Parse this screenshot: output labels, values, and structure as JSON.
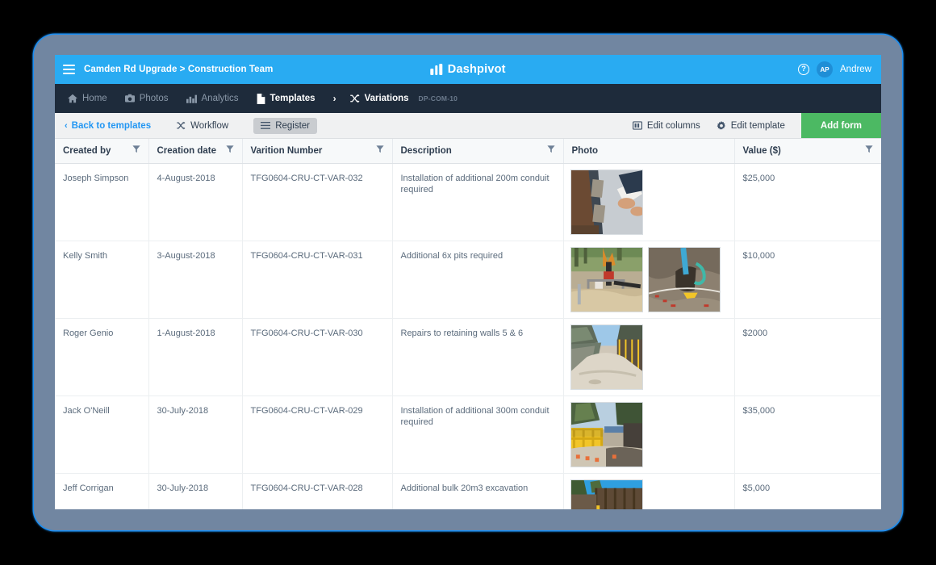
{
  "topbar": {
    "menu_icon": "hamburger-icon",
    "breadcrumb": "Camden Rd Upgrade > Construction Team",
    "brand": "Dashpivot",
    "help_icon": "question-mark-icon",
    "avatar_initials": "AP",
    "username": "Andrew",
    "bg_color": "#29abf2"
  },
  "nav": {
    "items": [
      {
        "label": "Home",
        "icon": "home-icon",
        "active": false
      },
      {
        "label": "Photos",
        "icon": "camera-icon",
        "active": false
      },
      {
        "label": "Analytics",
        "icon": "bar-chart-icon",
        "active": false
      },
      {
        "label": "Templates",
        "icon": "document-icon",
        "active": true
      }
    ],
    "separator": "›",
    "current": {
      "label": "Variations",
      "icon": "shuffle-icon",
      "code": "DP-COM-10"
    },
    "bg_color": "#1e2b3b"
  },
  "toolbar": {
    "back_label": "Back to templates",
    "back_chevron": "‹",
    "workflow_label": "Workflow",
    "workflow_icon": "shuffle-icon",
    "register_label": "Register",
    "register_icon": "list-icon",
    "edit_columns_label": "Edit columns",
    "edit_columns_icon": "columns-icon",
    "edit_template_label": "Edit template",
    "edit_template_icon": "gear-icon",
    "add_form_label": "Add form",
    "add_form_color": "#4cb963"
  },
  "table": {
    "columns": [
      {
        "label": "Created by",
        "filter": true
      },
      {
        "label": "Creation date",
        "filter": true
      },
      {
        "label": "Varition Number",
        "filter": true
      },
      {
        "label": "Description",
        "filter": true
      },
      {
        "label": "Photo",
        "filter": false
      },
      {
        "label": "Value ($)",
        "filter": true
      }
    ],
    "rows": [
      {
        "created_by": "Joseph Simpson",
        "creation_date": "4-August-2018",
        "variation_number": "TFG0604-CRU-CT-VAR-032",
        "description": "Installation of additional 200m conduit required",
        "photos": [
          "photo-timber-formwork-inspection"
        ],
        "value": "$25,000"
      },
      {
        "created_by": "Kelly Smith",
        "creation_date": "3-August-2018",
        "variation_number": "TFG0604-CRU-CT-VAR-031",
        "description": "Additional 6x pits required",
        "photos": [
          "photo-excavator-trench-work",
          "photo-rock-trench-conduit"
        ],
        "value": "$10,000"
      },
      {
        "created_by": "Roger Genio",
        "creation_date": "1-August-2018",
        "variation_number": "TFG0604-CRU-CT-VAR-030",
        "description": "Repairs to retaining walls 5 & 6",
        "photos": [
          "photo-retaining-wall-haul-road"
        ],
        "value": "$2000"
      },
      {
        "created_by": "Jack O'Neill",
        "creation_date": "30-July-2018",
        "variation_number": "TFG0604-CRU-CT-VAR-029",
        "description": "Installation of additional 300m conduit required",
        "photos": [
          "photo-yellow-barriers-site"
        ],
        "value": "$35,000"
      },
      {
        "created_by": "Jeff Corrigan",
        "creation_date": "30-July-2018",
        "variation_number": "TFG0604-CRU-CT-VAR-028",
        "description": "Additional bulk 20m3 excavation",
        "photos": [
          "photo-bulldozer-timber-wall"
        ],
        "value": "$5,000"
      }
    ]
  }
}
